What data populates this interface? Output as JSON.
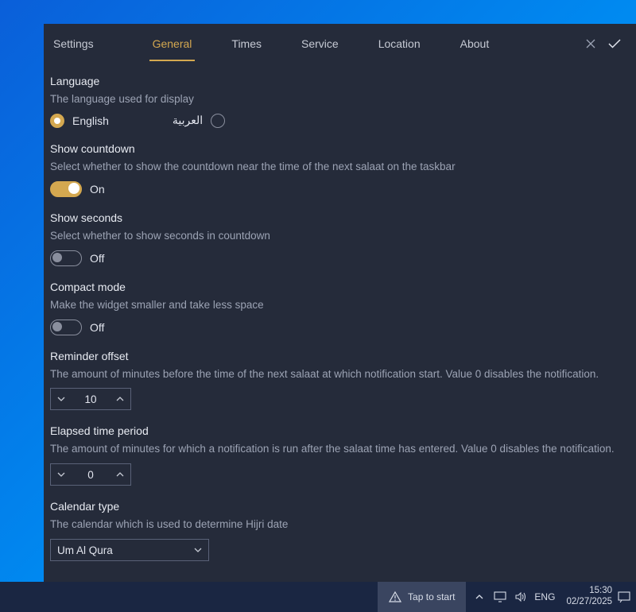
{
  "window_title": "Settings",
  "tabs": {
    "general": "General",
    "times": "Times",
    "service": "Service",
    "location": "Location",
    "about": "About",
    "active": "general"
  },
  "lang": {
    "title": "Language",
    "desc": "The language used for display",
    "english_label": "English",
    "arabic_label": "العربية",
    "selected": "english"
  },
  "countdown": {
    "title": "Show countdown",
    "desc": "Select whether to show the countdown near the time of the next salaat on the taskbar",
    "state_label": "On",
    "on": true
  },
  "seconds": {
    "title": "Show seconds",
    "desc": "Select whether to show seconds in countdown",
    "state_label": "Off",
    "on": false
  },
  "compact": {
    "title": "Compact mode",
    "desc": "Make the widget smaller and take less space",
    "state_label": "Off",
    "on": false
  },
  "reminder": {
    "title": "Reminder offset",
    "desc": "The amount of minutes before the time of the next salaat at which notification start. Value 0 disables the notification.",
    "value": "10"
  },
  "elapsed": {
    "title": "Elapsed time period",
    "desc": "The amount of minutes for which a notification is run after the salaat time has entered. Value 0 disables the notification.",
    "value": "0"
  },
  "calendar": {
    "title": "Calendar type",
    "desc": "The calendar which is used to determine Hijri date",
    "selected": "Um Al Qura"
  },
  "taskbar": {
    "tap_label": "Tap to start",
    "lang_indicator": "ENG",
    "time": "15:30",
    "date": "02/27/2025"
  }
}
